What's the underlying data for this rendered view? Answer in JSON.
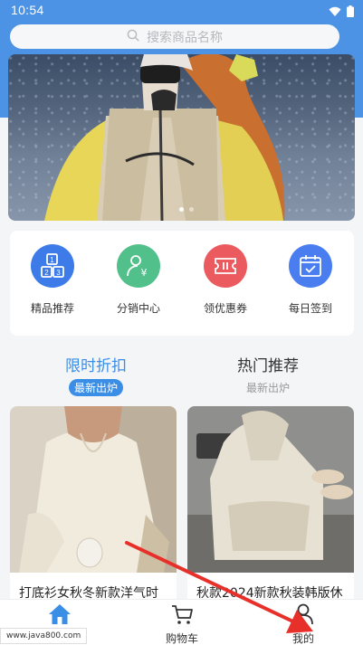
{
  "status_bar": {
    "time": "10:54"
  },
  "search": {
    "placeholder": "搜索商品名称"
  },
  "quick_links": [
    {
      "label": "精品推荐",
      "color": "#3d7be8",
      "icon": "grid-blocks-icon"
    },
    {
      "label": "分销中心",
      "color": "#52c08a",
      "icon": "user-yen-icon"
    },
    {
      "label": "领优惠券",
      "color": "#ea5a5f",
      "icon": "ticket-icon"
    },
    {
      "label": "每日签到",
      "color": "#4a7ef0",
      "icon": "calendar-check-icon"
    }
  ],
  "tabs": [
    {
      "title": "限时折扣",
      "subtitle": "最新出炉"
    },
    {
      "title": "热门推荐",
      "subtitle": "最新出炉"
    }
  ],
  "products": [
    {
      "name": "打底衫女秋冬新款洋气时"
    },
    {
      "name": "秋款2024新款秋装韩版休"
    }
  ],
  "tabbar": [
    {
      "label": "",
      "icon": "home-icon"
    },
    {
      "label": "购物车",
      "icon": "cart-icon"
    },
    {
      "label": "我的",
      "icon": "user-icon"
    }
  ],
  "watermark": "www.java800.com",
  "colors": {
    "accent": "#3a8ee6",
    "header": "#4c93e6"
  }
}
